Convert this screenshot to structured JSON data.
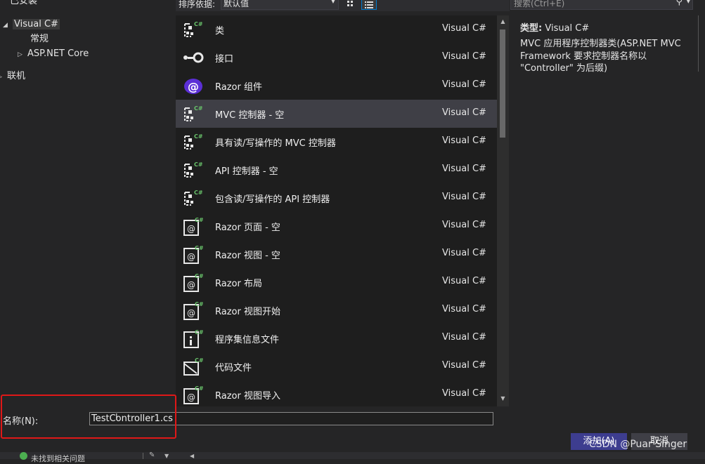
{
  "tree": {
    "installed_label": "已安装",
    "visual_csharp_label": "Visual C#",
    "general_label": "常规",
    "aspnet_core_label": "ASP.NET Core",
    "online_label": "联机"
  },
  "toolbar": {
    "sort_label": "排序依据:",
    "sort_value": "默认值",
    "search_placeholder": "搜索(Ctrl+E)"
  },
  "templates": [
    {
      "name": "类",
      "language": "Visual C#",
      "icon": "class-icon"
    },
    {
      "name": "接口",
      "language": "Visual C#",
      "icon": "interface-icon"
    },
    {
      "name": "Razor 组件",
      "language": "Visual C#",
      "icon": "razor-component-icon"
    },
    {
      "name": "MVC 控制器 - 空",
      "language": "Visual C#",
      "icon": "controller-icon",
      "selected": true
    },
    {
      "name": "具有读/写操作的 MVC 控制器",
      "language": "Visual C#",
      "icon": "controller-icon"
    },
    {
      "name": "API 控制器 - 空",
      "language": "Visual C#",
      "icon": "controller-icon"
    },
    {
      "name": "包含读/写操作的 API 控制器",
      "language": "Visual C#",
      "icon": "controller-icon"
    },
    {
      "name": "Razor 页面 - 空",
      "language": "Visual C#",
      "icon": "razor-page-icon"
    },
    {
      "name": "Razor 视图 - 空",
      "language": "Visual C#",
      "icon": "razor-view-icon"
    },
    {
      "name": "Razor 布局",
      "language": "Visual C#",
      "icon": "razor-layout-icon"
    },
    {
      "name": "Razor 视图开始",
      "language": "Visual C#",
      "icon": "razor-viewstart-icon"
    },
    {
      "name": "程序集信息文件",
      "language": "Visual C#",
      "icon": "assembly-info-icon"
    },
    {
      "name": "代码文件",
      "language": "Visual C#",
      "icon": "code-file-icon"
    },
    {
      "name": "Razor 视图导入",
      "language": "Visual C#",
      "icon": "razor-viewimports-icon"
    }
  ],
  "details": {
    "type_label": "类型:",
    "type_value": "Visual C#",
    "description": "MVC 应用程序控制器类(ASP.NET MVC Framework 要求控制器名称以 \"Controller\" 为后缀)"
  },
  "name_field": {
    "label": "名称(N):",
    "value": "TestController1.cs"
  },
  "buttons": {
    "add": "添加(A)",
    "cancel": "取消"
  },
  "watermark": "CSDN @Puar Singer",
  "status": {
    "text": "未找到相关问题"
  },
  "colors": {
    "background": "#252526",
    "list_background": "#1e1e1e",
    "selected_row": "#3f3f46",
    "highlight_box": "#e01818",
    "add_button": "#3d3d8f",
    "csharp_badge": "#68c26a"
  }
}
